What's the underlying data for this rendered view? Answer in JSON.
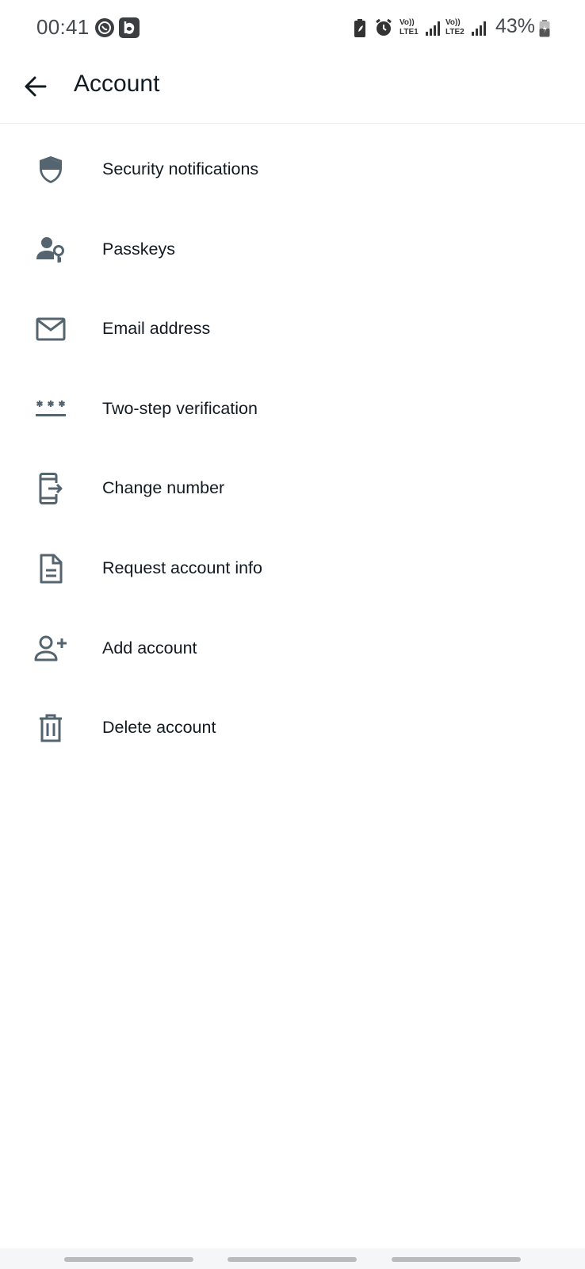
{
  "status_bar": {
    "time": "00:41",
    "sim1_label": "LTE1",
    "sim2_label": "LTE2",
    "volte_label": "Vo))",
    "battery_percent": "43%",
    "icons": [
      "whatsapp-status-icon",
      "b-app-icon",
      "battery-saver-icon",
      "alarm-icon",
      "signal-icon",
      "battery-icon"
    ]
  },
  "app_bar": {
    "title": "Account",
    "back_icon": "arrow-back-icon"
  },
  "menu": {
    "items": [
      {
        "label": "Security notifications",
        "icon": "shield-icon"
      },
      {
        "label": "Passkeys",
        "icon": "person-key-icon"
      },
      {
        "label": "Email address",
        "icon": "mail-icon"
      },
      {
        "label": "Two-step verification",
        "icon": "password-dots-icon"
      },
      {
        "label": "Change number",
        "icon": "phone-transfer-icon"
      },
      {
        "label": "Request account info",
        "icon": "document-icon"
      },
      {
        "label": "Add account",
        "icon": "person-add-icon"
      },
      {
        "label": "Delete account",
        "icon": "trash-icon"
      }
    ]
  },
  "colors": {
    "icon": "#54656f",
    "text": "#111b21",
    "divider": "#e9ecee",
    "status_text": "#444a4f"
  }
}
